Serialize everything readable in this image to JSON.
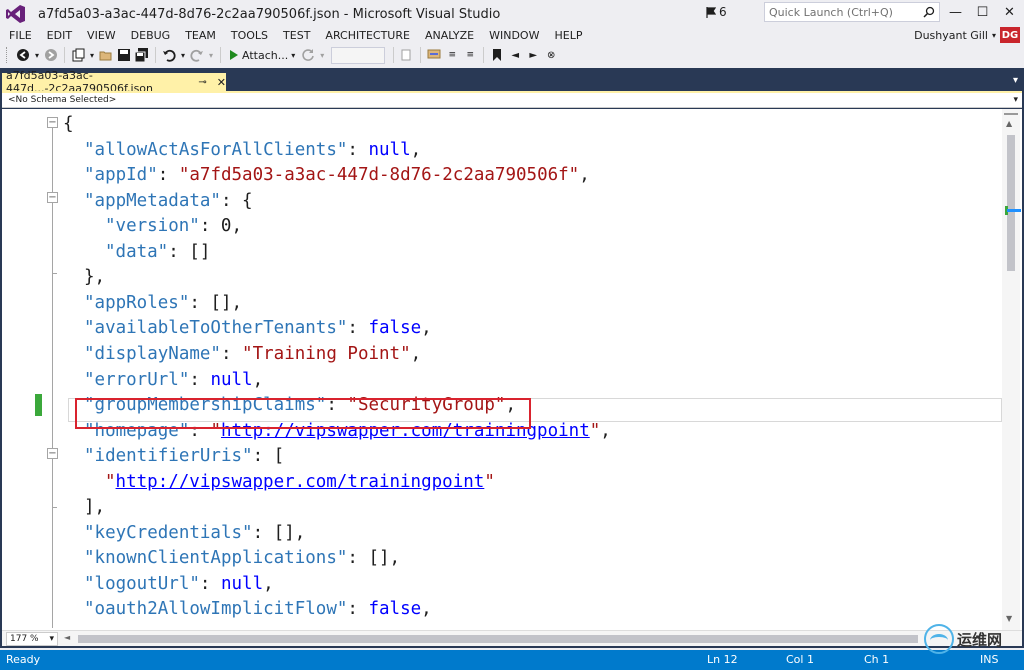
{
  "window": {
    "title": "a7fd5a03-a3ac-447d-8d76-2c2aa790506f.json - Microsoft Visual Studio",
    "notification_count": "6",
    "quick_launch_placeholder": "Quick Launch (Ctrl+Q)",
    "minimize": "—",
    "maximize": "☐",
    "close": "✕"
  },
  "menu": [
    "FILE",
    "EDIT",
    "VIEW",
    "DEBUG",
    "TEAM",
    "TOOLS",
    "TEST",
    "ARCHITECTURE",
    "ANALYZE",
    "WINDOW",
    "HELP"
  ],
  "user": {
    "name": "Dushyant Gill",
    "initials": "DG"
  },
  "toolbar": {
    "attach_label": "Attach..."
  },
  "document": {
    "tab_label": "a7fd5a03-a3ac-447d...-2c2aa790506f.json",
    "schema": "<No Schema Selected>"
  },
  "code": [
    {
      "kind": "open",
      "text": "{"
    },
    {
      "key": "\"allowActAsForAllClients\"",
      "sep": ": ",
      "lit": "null",
      "tail": ","
    },
    {
      "key": "\"appId\"",
      "sep": ": ",
      "str": "\"a7fd5a03-a3ac-447d-8d76-2c2aa790506f\"",
      "tail": ","
    },
    {
      "key": "\"appMetadata\"",
      "sep": ": ",
      "tail": "{"
    },
    {
      "key": "\"version\"",
      "sep": ": ",
      "num": "0",
      "tail": ","
    },
    {
      "key": "\"data\"",
      "sep": ": ",
      "tail": "[]"
    },
    {
      "kind": "close",
      "text": "},"
    },
    {
      "key": "\"appRoles\"",
      "sep": ": ",
      "tail": "[],"
    },
    {
      "key": "\"availableToOtherTenants\"",
      "sep": ": ",
      "lit": "false",
      "tail": ","
    },
    {
      "key": "\"displayName\"",
      "sep": ": ",
      "str": "\"Training Point\"",
      "tail": ","
    },
    {
      "key": "\"errorUrl\"",
      "sep": ": ",
      "lit": "null",
      "tail": ","
    },
    {
      "key": "\"groupMembershipClaims\"",
      "sep": ": ",
      "str": "\"SecurityGroup\"",
      "tail": ","
    },
    {
      "key": "\"homepage\"",
      "sep": ": ",
      "q1": "\"",
      "link": "http://vipswapper.com/trainingpoint",
      "q2": "\"",
      "tail": ","
    },
    {
      "key": "\"identifierUris\"",
      "sep": ": ",
      "tail": "["
    },
    {
      "q1": "\"",
      "link": "http://vipswapper.com/trainingpoint",
      "q2": "\""
    },
    {
      "kind": "close",
      "text": "],"
    },
    {
      "key": "\"keyCredentials\"",
      "sep": ": ",
      "tail": "[],"
    },
    {
      "key": "\"knownClientApplications\"",
      "sep": ": ",
      "tail": "[],"
    },
    {
      "key": "\"logoutUrl\"",
      "sep": ": ",
      "lit": "null",
      "tail": ","
    },
    {
      "key": "\"oauth2AllowImplicitFlow\"",
      "sep": ": ",
      "lit": "false",
      "tail": ","
    }
  ],
  "editor": {
    "zoom": "177 %"
  },
  "status": {
    "ready": "Ready",
    "line": "Ln 12",
    "col": "Col 1",
    "ch": "Ch 1",
    "mode": "INS"
  },
  "watermark": {
    "text": "运维网"
  }
}
